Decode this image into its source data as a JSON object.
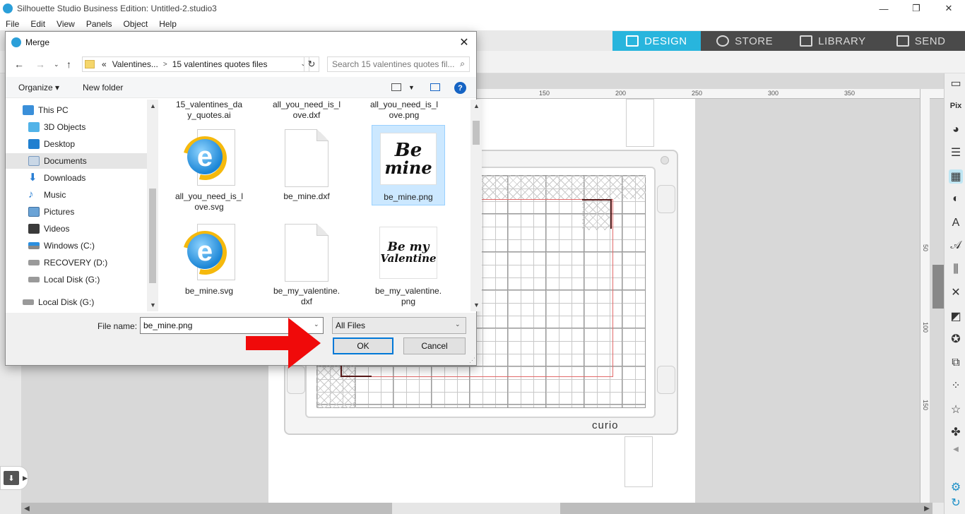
{
  "app": {
    "title": "Silhouette Studio Business Edition: Untitled-2.studio3",
    "window_controls": [
      "—",
      "❐",
      "✕"
    ],
    "menu": [
      "File",
      "Edit",
      "View",
      "Panels",
      "Object",
      "Help"
    ],
    "tabs": [
      {
        "label": "DESIGN",
        "active": true
      },
      {
        "label": "STORE",
        "active": false
      },
      {
        "label": "LIBRARY",
        "active": false
      },
      {
        "label": "SEND",
        "active": false
      }
    ],
    "ruler_top": [
      "150",
      "200",
      "250",
      "300",
      "350"
    ],
    "ruler_right": [
      "50",
      "100",
      "150"
    ],
    "mat_brand": "curio",
    "accent": "#28b5dd"
  },
  "dialog": {
    "title": "Merge",
    "close": "✕",
    "breadcrumb": {
      "prefix": "«",
      "parent": "Valentines...",
      "current": "15 valentines quotes files"
    },
    "search_placeholder": "Search 15 valentines quotes fil...",
    "organize_label": "Organize",
    "new_folder_label": "New folder",
    "help": "?",
    "nav_items": [
      {
        "label": "This PC",
        "selected": false
      },
      {
        "label": "3D Objects",
        "selected": false
      },
      {
        "label": "Desktop",
        "selected": false
      },
      {
        "label": "Documents",
        "selected": true
      },
      {
        "label": "Downloads",
        "selected": false
      },
      {
        "label": "Music",
        "selected": false
      },
      {
        "label": "Pictures",
        "selected": false
      },
      {
        "label": "Videos",
        "selected": false
      },
      {
        "label": "Windows (C:)",
        "selected": false
      },
      {
        "label": "RECOVERY (D:)",
        "selected": false
      },
      {
        "label": "Local Disk (G:)",
        "selected": false
      },
      {
        "label": "Local Disk (G:)",
        "selected": false
      }
    ],
    "files": [
      {
        "line1": "15_valentines_da",
        "line2": "y_quotes.ai",
        "kind": "none",
        "selected": false
      },
      {
        "line1": "all_you_need_is_l",
        "line2": "ove.dxf",
        "kind": "none",
        "selected": false
      },
      {
        "line1": "all_you_need_is_l",
        "line2": "ove.png",
        "kind": "none",
        "selected": false
      },
      {
        "line1": "all_you_need_is_l",
        "line2": "ove.svg",
        "kind": "ie",
        "selected": false
      },
      {
        "line1": "be_mine.dxf",
        "line2": "",
        "kind": "blank",
        "selected": false
      },
      {
        "line1": "be_mine.png",
        "line2": "",
        "kind": "png-bemine",
        "selected": true
      },
      {
        "line1": "be_mine.svg",
        "line2": "",
        "kind": "ie",
        "selected": false
      },
      {
        "line1": "be_my_valentine.",
        "line2": "dxf",
        "kind": "blank",
        "selected": false
      },
      {
        "line1": "be_my_valentine.",
        "line2": "png",
        "kind": "png-valentine",
        "selected": false
      }
    ],
    "thumb_text": {
      "bemine_1": "Be",
      "bemine_2": "mine",
      "valentine_1": "Be my",
      "valentine_2": "Valentine"
    },
    "file_name_label": "File name:",
    "file_name_value": "be_mine.png",
    "file_type_value": "All Files",
    "ok_label": "OK",
    "cancel_label": "Cancel"
  }
}
